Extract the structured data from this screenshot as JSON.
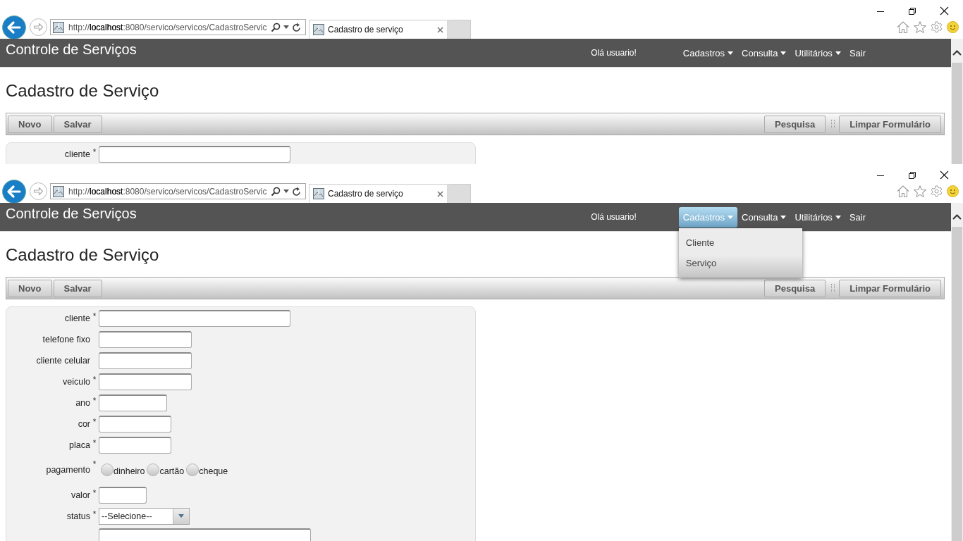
{
  "frames": [
    {
      "browser": {
        "address": "http://**localhost**:8080/servico/servicos/CadastroServic",
        "tab_title": "Cadastro de serviço"
      },
      "app": {
        "brand": "Controle de Serviços",
        "greeting": "Olá usuario!",
        "nav": [
          {
            "kind": "dropdown",
            "label": "Cadastros",
            "expanded": false
          },
          {
            "kind": "dropdown",
            "label": "Consulta",
            "expanded": false
          },
          {
            "kind": "dropdown",
            "label": "Utilitários",
            "expanded": false
          },
          {
            "kind": "link",
            "label": "Sair",
            "expanded": false
          }
        ],
        "page_title": "Cadastro de Serviço",
        "toolbar": {
          "left": [
            "Novo",
            "Salvar"
          ],
          "right": [
            "Pesquisa",
            "Limpar Formulário"
          ]
        },
        "form": {
          "required_mark": "*",
          "fields": [
            {
              "kind": "text",
              "label": "cliente",
              "required": true
            }
          ]
        }
      }
    },
    {
      "browser": {
        "address": "http://**localhost**:8080/servico/servicos/CadastroServic",
        "tab_title": "Cadastro de serviço"
      },
      "app": {
        "brand": "Controle de Serviços",
        "greeting": "Olá usuario!",
        "nav": [
          {
            "kind": "dropdown",
            "label": "Cadastros",
            "expanded": true,
            "menu": [
              "Cliente",
              "Serviço"
            ]
          },
          {
            "kind": "dropdown",
            "label": "Consulta",
            "expanded": false
          },
          {
            "kind": "dropdown",
            "label": "Utilitários",
            "expanded": false
          },
          {
            "kind": "link",
            "label": "Sair",
            "expanded": false
          }
        ],
        "page_title": "Cadastro de Serviço",
        "toolbar": {
          "left": [
            "Novo",
            "Salvar"
          ],
          "right": [
            "Pesquisa",
            "Limpar Formulário"
          ]
        },
        "form": {
          "required_mark": "*",
          "fields": [
            {
              "kind": "text",
              "label": "cliente",
              "required": true
            },
            {
              "kind": "text",
              "label": "telefone fixo",
              "required": false
            },
            {
              "kind": "text",
              "label": "cliente celular",
              "required": false
            },
            {
              "kind": "text",
              "label": "veiculo",
              "required": true
            },
            {
              "kind": "text",
              "label": "ano",
              "required": true
            },
            {
              "kind": "text",
              "label": "cor",
              "required": true
            },
            {
              "kind": "text",
              "label": "placa",
              "required": true
            },
            {
              "kind": "radio",
              "label": "pagamento",
              "required": true,
              "options": [
                {
                  "label": "dinheiro",
                  "selected": false
                },
                {
                  "label": "cartão",
                  "selected": false
                },
                {
                  "label": "cheque",
                  "selected": false
                }
              ]
            },
            {
              "kind": "text",
              "label": "valor",
              "required": true
            },
            {
              "kind": "select",
              "label": "status",
              "required": true,
              "value": "--Selecione--"
            },
            {
              "kind": "textarea",
              "required": false
            }
          ]
        }
      }
    }
  ]
}
